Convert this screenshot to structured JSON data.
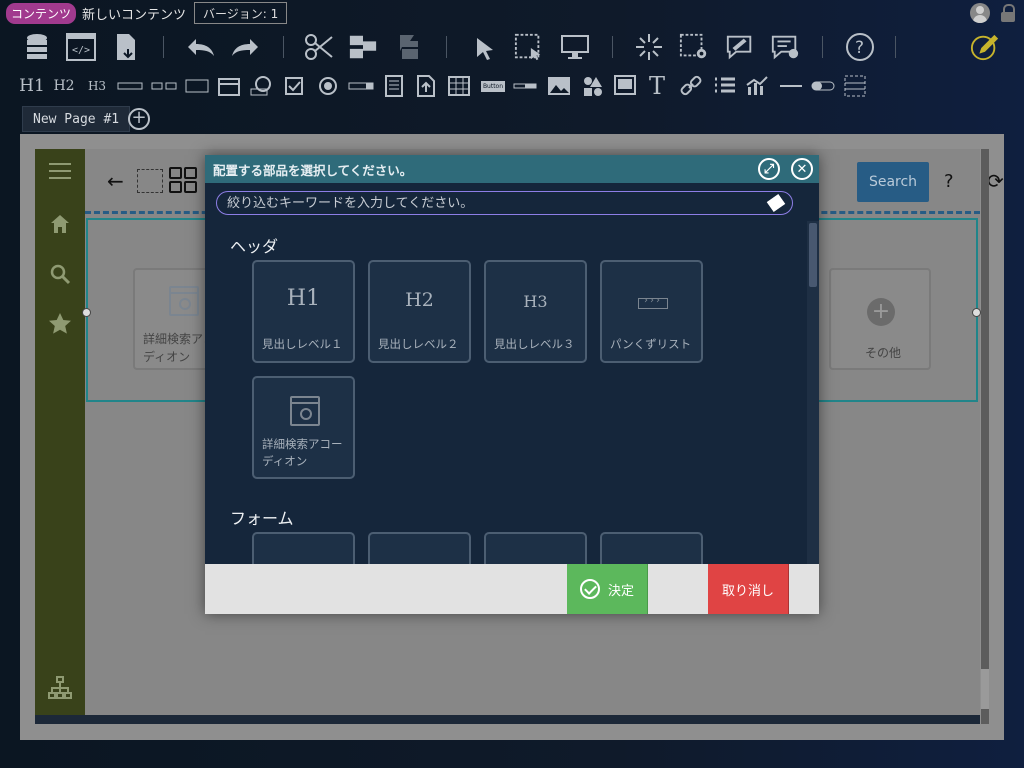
{
  "topbar": {
    "app_badge": "コンテンツ",
    "doc_title": "新しいコンテンツ",
    "version": "バージョン: 1"
  },
  "toolbar1": {
    "icons": [
      "database-icon",
      "html-code-icon",
      "download-doc-icon",
      "undo-icon",
      "redo-icon",
      "cut-icon",
      "copy-blocks-icon",
      "paste-icon",
      "select-pointer-icon",
      "select-region-icon",
      "preview-monitor-icon",
      "sparkle-icon",
      "region-settings-icon",
      "comment-edit-icon",
      "comment-settings-icon",
      "help-icon",
      "edit-pencil-icon"
    ]
  },
  "toolbar2": {
    "h1": "H1",
    "h2": "H2",
    "h3": "H3",
    "button_label": "Button",
    "text_tool": "T",
    "icons": [
      "input-icon",
      "range-input-icon",
      "textbox-icon",
      "date-icon",
      "time-icon",
      "checkbox-icon",
      "radio-icon",
      "select-icon",
      "document-icon",
      "upload-icon",
      "table-icon",
      "button-icon",
      "line-icon",
      "image-icon",
      "shapes-icon",
      "monitor-icon",
      "text-icon",
      "link-icon",
      "list-icon",
      "chart-icon",
      "hr-icon",
      "toggle-icon",
      "placeholder-icon"
    ]
  },
  "tabs": {
    "page_tab": "New Page #1",
    "add_tab": "+"
  },
  "preview": {
    "search_button": "Search",
    "help": "?",
    "reload": "⟳",
    "back": "←",
    "card1_line1": "詳細検索アコー",
    "card1_line2": "ディオン",
    "card_other": "その他",
    "plus": "+"
  },
  "modal": {
    "title": "配置する部品を選択してください。",
    "search_placeholder": "絞り込むキーワードを入力してください。",
    "categories": [
      {
        "name": "ヘッダ",
        "items": [
          {
            "icon": "H1",
            "label": "見出しレベル１"
          },
          {
            "icon": "H2",
            "label": "見出しレベル２"
          },
          {
            "icon": "H3",
            "label": "見出しレベル３"
          },
          {
            "icon": "",
            "label": "パンくずリスト"
          },
          {
            "icon": "",
            "label_line1": "詳細検索アコー",
            "label_line2": "ディオン"
          }
        ]
      },
      {
        "name": "フォーム",
        "items": []
      }
    ],
    "ok_button": "決定",
    "cancel_button": "取り消し"
  }
}
